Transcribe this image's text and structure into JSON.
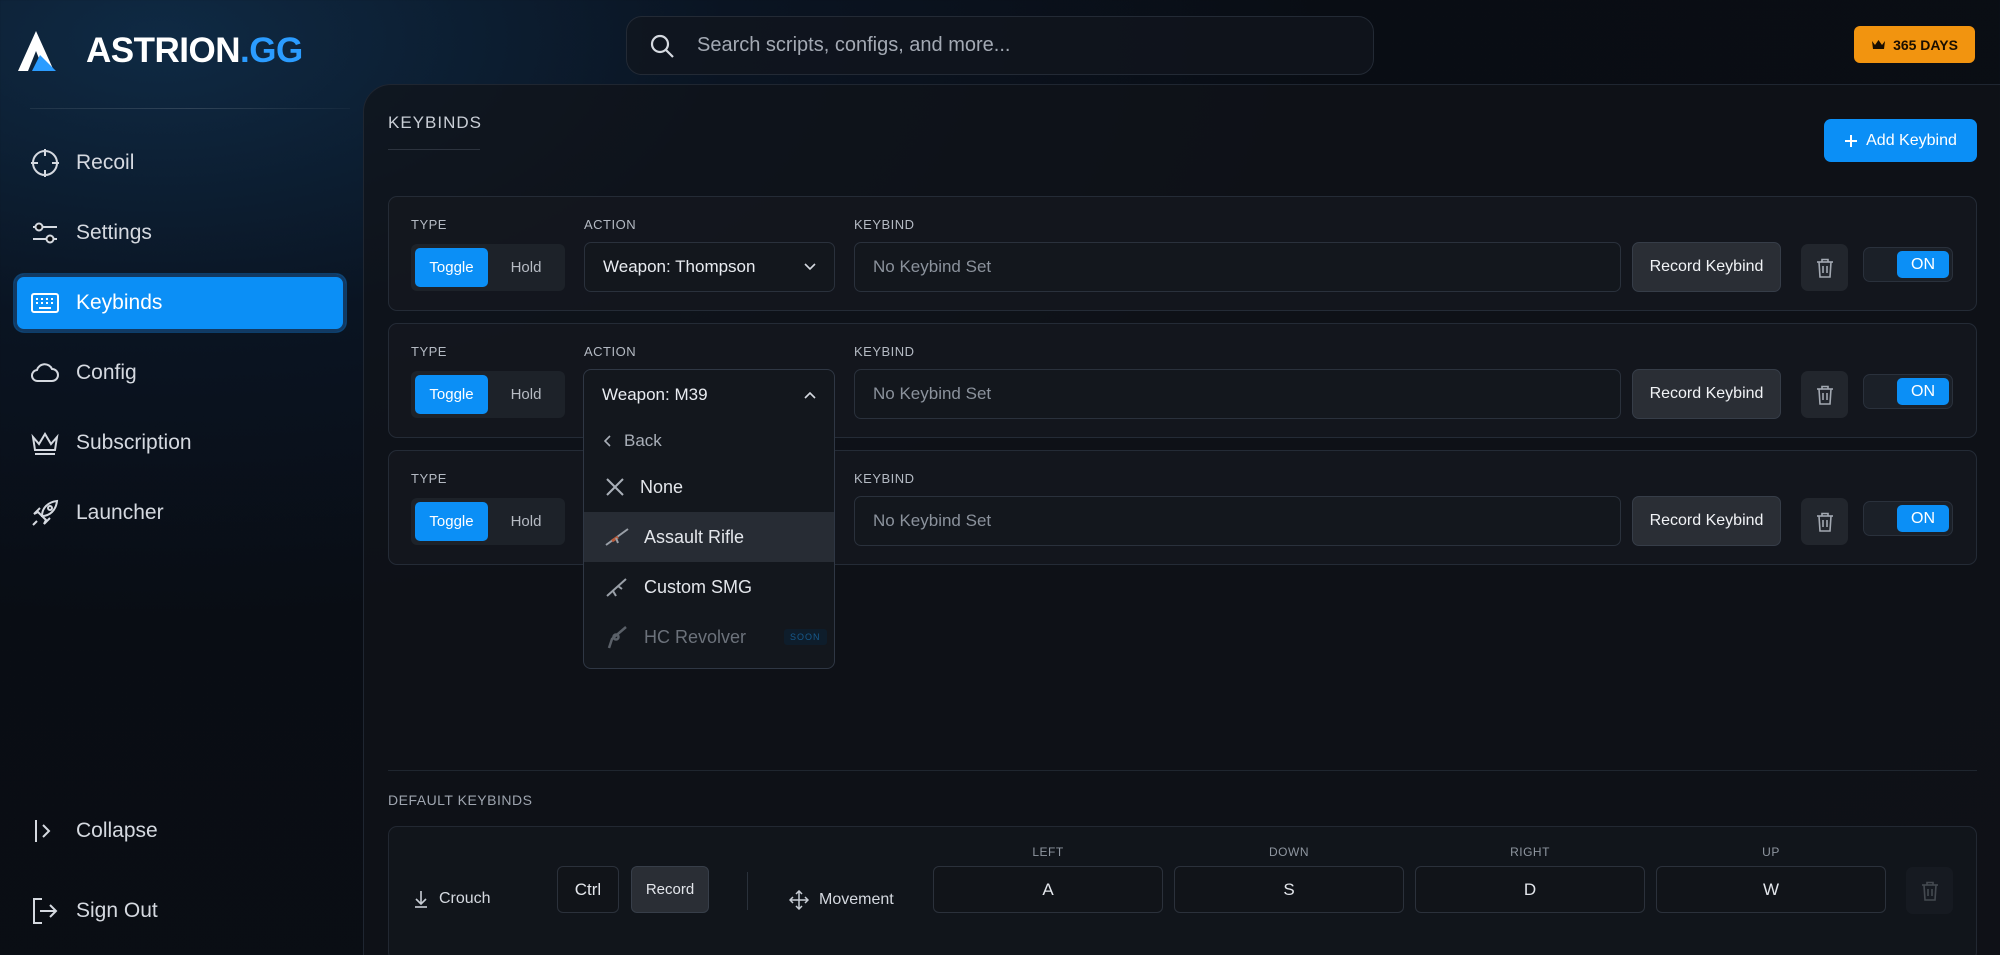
{
  "brand": {
    "name": "ASTRION",
    "suffix": ".GG"
  },
  "search": {
    "placeholder": "Search scripts, configs, and more..."
  },
  "subscription": {
    "label": "365 DAYS"
  },
  "nav": {
    "items": [
      {
        "label": "Recoil",
        "icon": "crosshair-icon"
      },
      {
        "label": "Settings",
        "icon": "sliders-icon"
      },
      {
        "label": "Keybinds",
        "icon": "keyboard-icon",
        "active": true
      },
      {
        "label": "Config",
        "icon": "cloud-icon"
      },
      {
        "label": "Subscription",
        "icon": "crown-icon"
      },
      {
        "label": "Launcher",
        "icon": "rocket-icon"
      }
    ],
    "collapse": "Collapse",
    "signout": "Sign Out"
  },
  "page": {
    "title": "KEYBINDS",
    "add_label": "Add Keybind"
  },
  "labels": {
    "type": "TYPE",
    "action": "ACTION",
    "keybind": "KEYBIND"
  },
  "rows": [
    {
      "type_on": "Toggle",
      "type_off": "Hold",
      "action": "Weapon: Thompson",
      "keybind_placeholder": "No Keybind Set",
      "record": "Record Keybind",
      "state": "ON"
    },
    {
      "type_on": "Toggle",
      "type_off": "Hold",
      "action": "Weapon: M39",
      "keybind_placeholder": "No Keybind Set",
      "record": "Record Keybind",
      "state": "ON"
    },
    {
      "type_on": "Toggle",
      "type_off": "Hold",
      "action": "",
      "keybind_placeholder": "No Keybind Set",
      "record": "Record Keybind",
      "state": "ON"
    }
  ],
  "dropdown": {
    "selected": "Weapon: M39",
    "back": "Back",
    "options": [
      {
        "label": "None",
        "icon": "x-icon"
      },
      {
        "label": "Assault Rifle",
        "icon": "assault-rifle-icon",
        "highlighted": true
      },
      {
        "label": "Custom SMG",
        "icon": "smg-icon"
      },
      {
        "label": "HC Revolver",
        "icon": "revolver-icon",
        "disabled": true,
        "badge": "SOON"
      }
    ]
  },
  "defaults": {
    "title": "DEFAULT KEYBINDS",
    "crouch": {
      "label": "Crouch",
      "key": "Ctrl",
      "record": "Record"
    },
    "movement": {
      "label": "Movement",
      "left": {
        "label": "LEFT",
        "key": "A"
      },
      "down": {
        "label": "DOWN",
        "key": "S"
      },
      "right": {
        "label": "RIGHT",
        "key": "D"
      },
      "up": {
        "label": "UP",
        "key": "W"
      }
    }
  },
  "colors": {
    "accent": "#0b8ff6",
    "gold": "#f2940f",
    "bg": "#0b0e13"
  }
}
